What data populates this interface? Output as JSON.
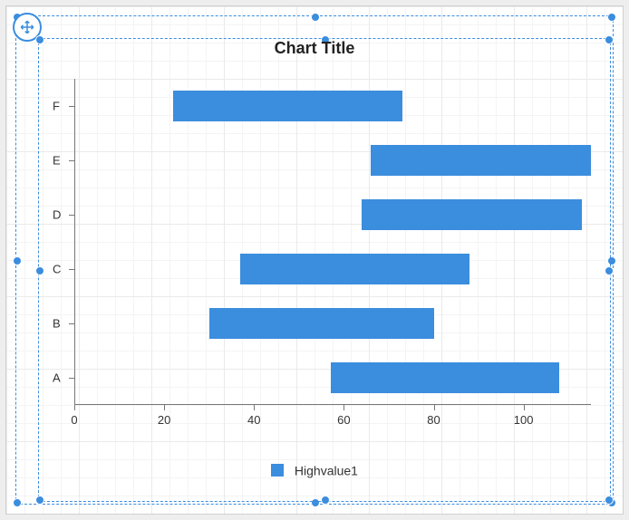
{
  "chart_data": {
    "type": "bar",
    "orientation": "horizontal",
    "title": "Chart Title",
    "categories": [
      "A",
      "B",
      "C",
      "D",
      "E",
      "F"
    ],
    "series": [
      {
        "name": "Highvalue1",
        "low": [
          57,
          30,
          37,
          64,
          66,
          22
        ],
        "high": [
          108,
          80,
          88,
          113,
          115,
          73
        ]
      }
    ],
    "xlim": [
      0,
      115
    ],
    "xticks": [
      0,
      20,
      40,
      60,
      80,
      100
    ],
    "xlabel": "",
    "ylabel": "",
    "legend": [
      "Highvalue1"
    ],
    "accent_color": "#3B8DDE"
  },
  "editor": {
    "selected": true,
    "grip_tooltip": "Move"
  }
}
